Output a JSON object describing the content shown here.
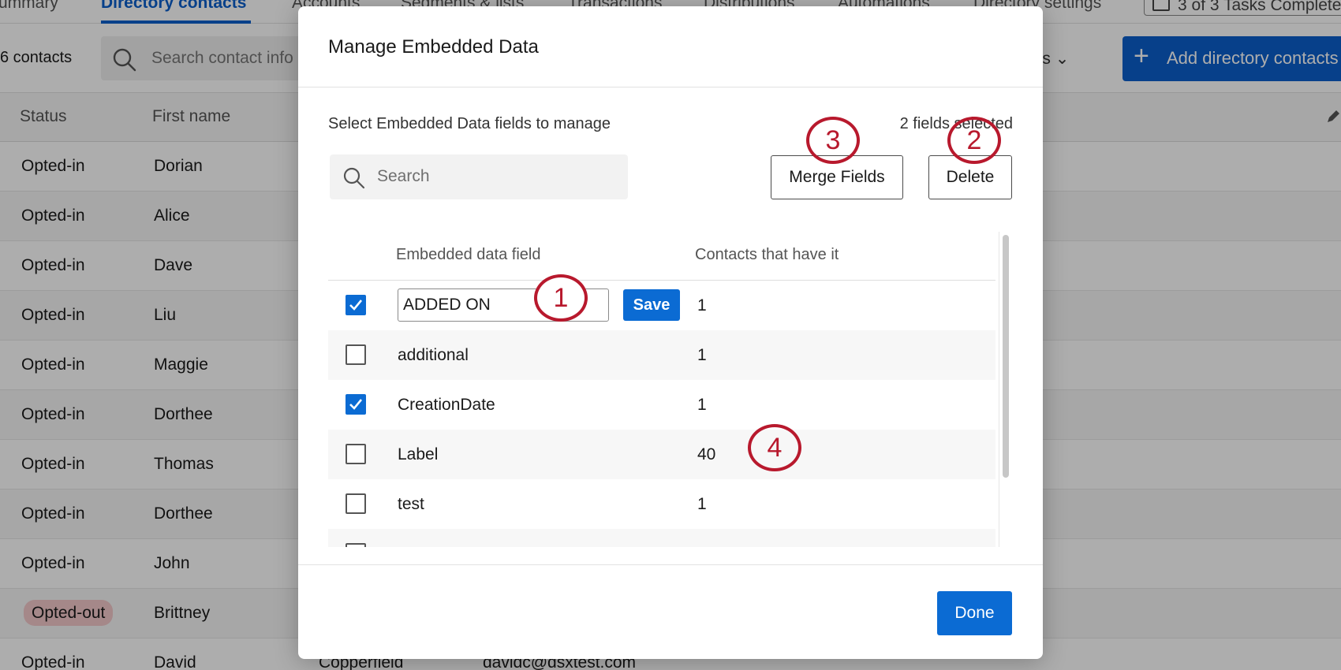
{
  "background": {
    "tabs": [
      {
        "label": "ummary",
        "active": false
      },
      {
        "label": "Directory contacts",
        "active": true
      },
      {
        "label": "Accounts",
        "active": false
      },
      {
        "label": "Segments & lists",
        "active": false
      },
      {
        "label": "Transactions",
        "active": false
      },
      {
        "label": "Distributions",
        "active": false
      },
      {
        "label": "Automations",
        "active": false
      },
      {
        "label": "Directory settings",
        "active": false
      }
    ],
    "tasks_label": "3 of 3 Tasks Complete",
    "contact_count": "6 contacts",
    "search_placeholder": "Search contact info",
    "options_label": "ons",
    "add_button_label": "Add directory contacts",
    "columns": [
      "Status",
      "First name"
    ],
    "rows": [
      {
        "status": "Opted-in",
        "first": "Dorian",
        "last": "",
        "email": ""
      },
      {
        "status": "Opted-in",
        "first": "Alice",
        "last": "",
        "email": ""
      },
      {
        "status": "Opted-in",
        "first": "Dave",
        "last": "",
        "email": ""
      },
      {
        "status": "Opted-in",
        "first": "Liu",
        "last": "",
        "email": ""
      },
      {
        "status": "Opted-in",
        "first": "Maggie",
        "last": "",
        "email": ""
      },
      {
        "status": "Opted-in",
        "first": "Dorthee",
        "last": "",
        "email": ""
      },
      {
        "status": "Opted-in",
        "first": "Thomas",
        "last": "",
        "email": ""
      },
      {
        "status": "Opted-in",
        "first": "Dorthee",
        "last": "",
        "email": ""
      },
      {
        "status": "Opted-in",
        "first": "John",
        "last": "",
        "email": ""
      },
      {
        "status": "Opted-out",
        "first": "Brittney",
        "last": "",
        "email": ""
      },
      {
        "status": "Opted-in",
        "first": "David",
        "last": "Copperfield",
        "email": "davidc@dsxtest.com"
      }
    ]
  },
  "modal": {
    "title": "Manage Embedded Data",
    "instructions": "Select Embedded Data fields to manage",
    "fields_selected": "2 fields selected",
    "search_placeholder": "Search",
    "merge_label": "Merge Fields",
    "delete_label": "Delete",
    "columns": {
      "field": "Embedded data field",
      "contacts": "Contacts that have it"
    },
    "rows": [
      {
        "name": "ADDED ON",
        "count": "1",
        "checked": true,
        "editing": true
      },
      {
        "name": "additional",
        "count": "1",
        "checked": false,
        "editing": false
      },
      {
        "name": "CreationDate",
        "count": "1",
        "checked": true,
        "editing": false
      },
      {
        "name": "Label",
        "count": "40",
        "checked": false,
        "editing": false
      },
      {
        "name": "test",
        "count": "1",
        "checked": false,
        "editing": false
      }
    ],
    "save_label": "Save",
    "done_label": "Done"
  },
  "callouts": [
    "1",
    "2",
    "3",
    "4"
  ],
  "colors": {
    "accent": "#0b6bd3",
    "callout": "#b8192d",
    "opted_out_badge": "#f3c9cb"
  }
}
